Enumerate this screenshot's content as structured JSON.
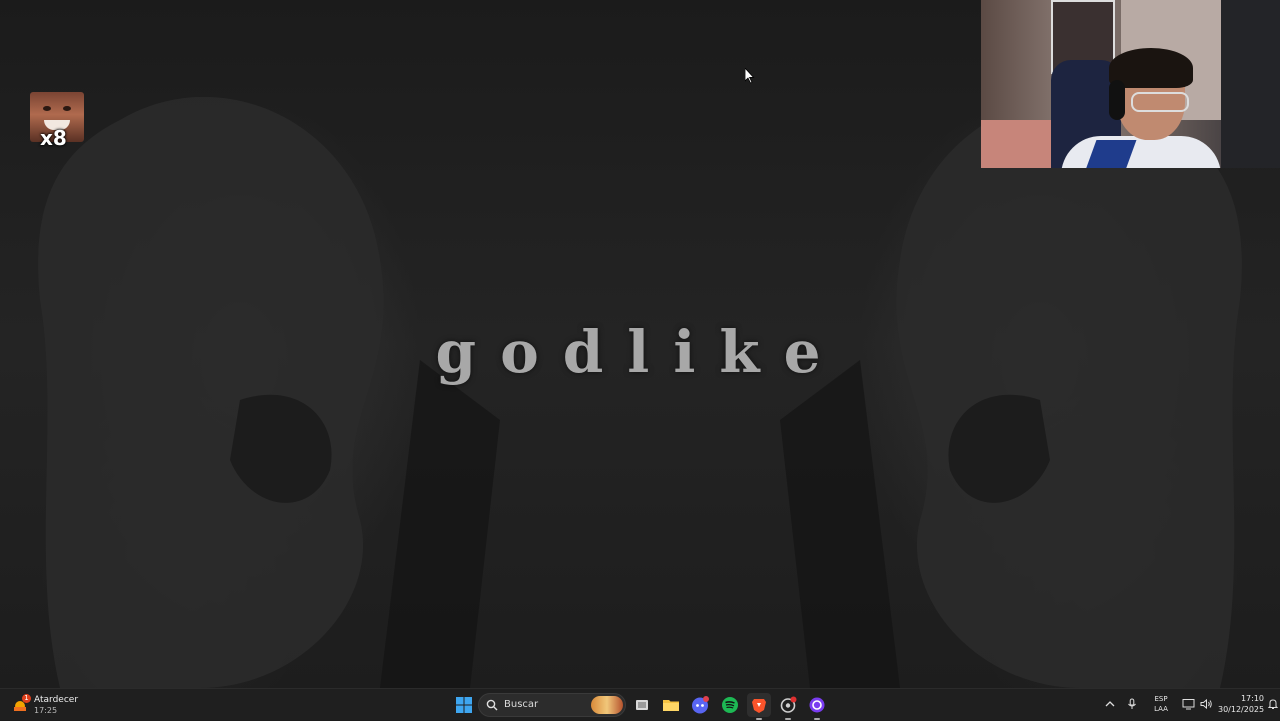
{
  "video": {
    "title_text": "godlike"
  },
  "overlay": {
    "emote_multiplier": "x8"
  },
  "taskbar": {
    "weather": {
      "label": "Atardecer",
      "time": "17:25",
      "badge": "1",
      "icon": "weather-sunset-icon"
    },
    "search": {
      "label": "Buscar"
    },
    "apps": [
      {
        "name": "start",
        "icon": "windows-icon"
      },
      {
        "name": "task-view",
        "icon": "task-view-icon"
      },
      {
        "name": "file-explorer",
        "icon": "folder-icon"
      },
      {
        "name": "discord",
        "icon": "discord-icon"
      },
      {
        "name": "spotify",
        "icon": "spotify-icon"
      },
      {
        "name": "brave",
        "icon": "brave-icon"
      },
      {
        "name": "app-red-dot",
        "icon": "app-icon"
      },
      {
        "name": "app-purple",
        "icon": "circle-app-icon"
      }
    ],
    "language": {
      "line1": "ESP",
      "line2": "LAA"
    },
    "clock": {
      "time": "17:10",
      "date": "30/12/2025"
    }
  },
  "colors": {
    "taskbar_bg": "#1f1f1f",
    "title_color": "#a8a8a8",
    "spotify_green": "#1db954",
    "brave_orange": "#fb542b",
    "windows_blue": "#3ea6f0"
  }
}
